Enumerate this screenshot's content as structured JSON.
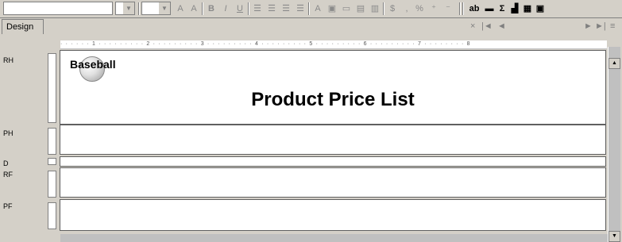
{
  "toolbar": {
    "align_buttons": [
      "B",
      "I",
      "U"
    ],
    "right_buttons": [
      "ab",
      "Σ"
    ]
  },
  "tabs": {
    "design": "Design"
  },
  "nav": {
    "close": "×",
    "first": "|◄",
    "prev": "◄",
    "next": "►",
    "last": "►|",
    "menu": "≡"
  },
  "ruler": {
    "marks": "· · · · · · 1 · · · · · · · · · 2 · · · · · · · · · 3 · · · · · · · · · 4 · · · · · · · · · 5 · · · · · · · · · 6 · · · · · · · · · 7 · · · · · · · · 8"
  },
  "sections": {
    "report_header": "RH",
    "page_header": "PH",
    "detail": "D",
    "report_footer": "RF",
    "page_footer": "PF"
  },
  "report": {
    "logo_text": "Baseball",
    "title": "Product Price List"
  }
}
